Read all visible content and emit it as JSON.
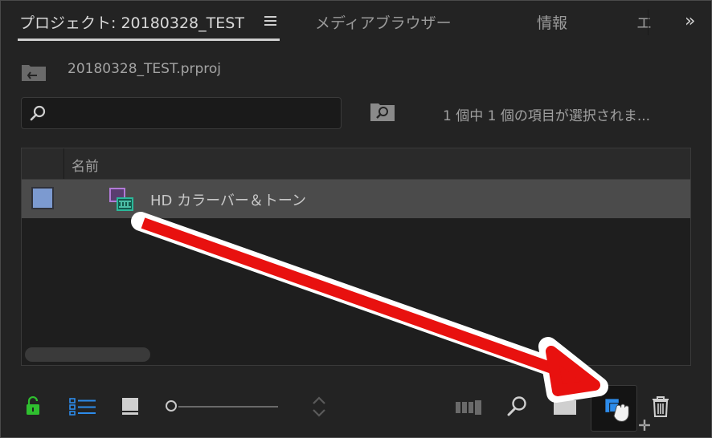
{
  "tabs": {
    "project_label": "プロジェクト: 20180328_TEST",
    "media_browser": "メディアブラウザー",
    "info": "情報",
    "truncated": "エ",
    "overflow": "»"
  },
  "project": {
    "file_name": "20180328_TEST.prproj",
    "status": "1 個中 1 個の項目が選択されま..."
  },
  "search": {
    "value": "",
    "placeholder": ""
  },
  "list": {
    "column_name": "名前",
    "items": [
      {
        "label": "HD カラーバー＆トーン",
        "swatch_color": "#7c9ad0",
        "icon": "color-bars-clip-icon"
      }
    ]
  },
  "toolbar": {
    "icons": [
      "lock-icon",
      "list-view-icon",
      "icon-view-icon",
      "zoom-slider",
      "sort-icon",
      "automate-to-sequence-icon",
      "find-icon",
      "new-bin-icon",
      "new-item-icon",
      "trash-icon"
    ]
  },
  "colors": {
    "background": "#232323",
    "accent_blue": "#2d8ceb",
    "lock_green": "#2fbf2f",
    "arrow_red": "#e8110f"
  }
}
